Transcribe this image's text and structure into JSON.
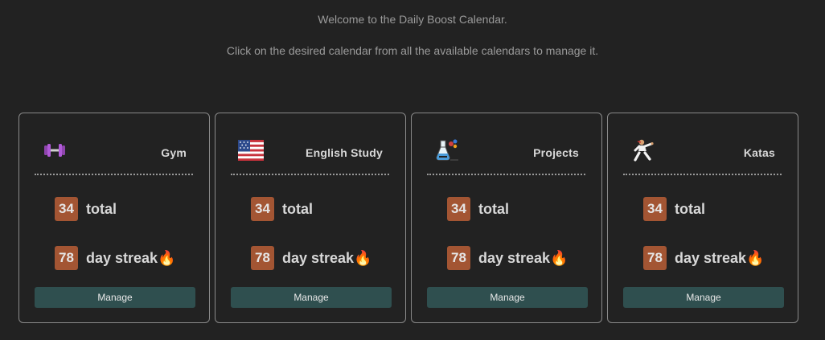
{
  "header": {
    "welcome": "Welcome to the Daily Boost Calendar.",
    "instructions": "Click on the desired calendar from all the available calendars to manage it."
  },
  "calendars": [
    {
      "title": "Gym",
      "icon": "dumbbell-icon",
      "total": "34",
      "total_label": "total",
      "streak": "78",
      "streak_label": "day streak🔥",
      "manage_label": "Manage"
    },
    {
      "title": "English Study",
      "icon": "us-flag-icon",
      "total": "34",
      "total_label": "total",
      "streak": "78",
      "streak_label": "day streak🔥",
      "manage_label": "Manage"
    },
    {
      "title": "Projects",
      "icon": "lab-flask-icon",
      "total": "34",
      "total_label": "total",
      "streak": "78",
      "streak_label": "day streak🔥",
      "manage_label": "Manage"
    },
    {
      "title": "Katas",
      "icon": "martial-artist-icon",
      "total": "34",
      "total_label": "total",
      "streak": "78",
      "streak_label": "day streak🔥",
      "manage_label": "Manage"
    }
  ],
  "colors": {
    "background": "#222222",
    "card_border": "#8a8a8a",
    "badge": "#a35533",
    "button": "#2f4f4f",
    "text_muted": "#9a9a9a",
    "text": "#d8d8d8"
  }
}
